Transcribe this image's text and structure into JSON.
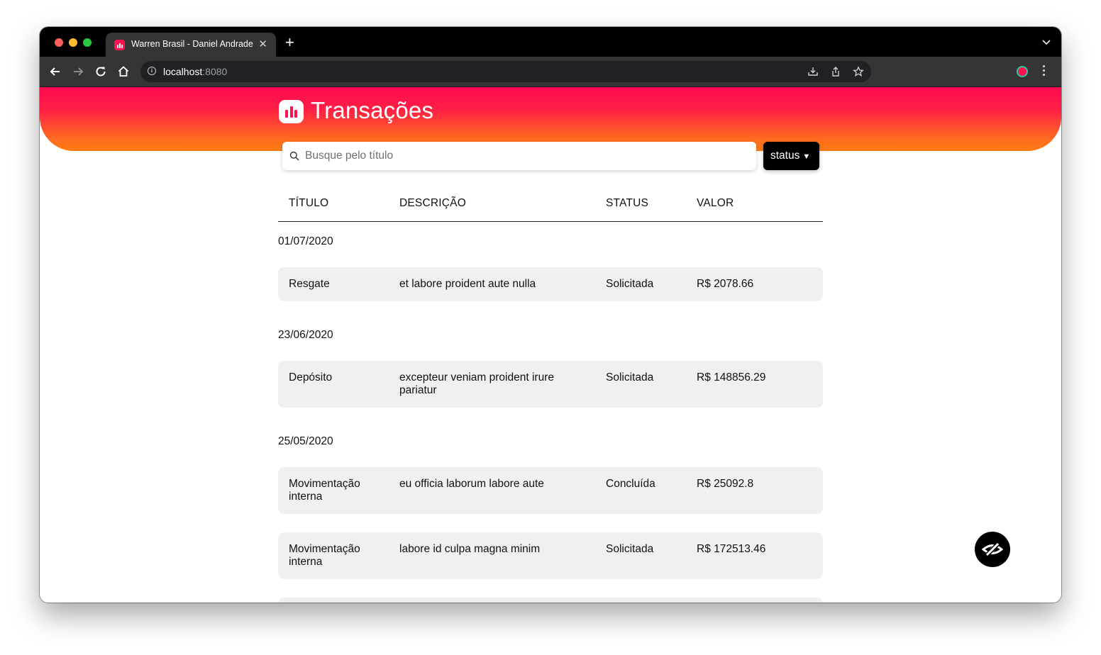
{
  "browser": {
    "tab_title": "Warren Brasil - Daniel Andrade",
    "tab_close_glyph": "✕",
    "new_tab_glyph": "+",
    "url_host": "localhost",
    "url_port": ":8080",
    "url_info_glyph": "i"
  },
  "header": {
    "title": "Transações",
    "brand_color": "#ff1451"
  },
  "search": {
    "placeholder": "Busque pelo título",
    "value": ""
  },
  "filter": {
    "label": "status",
    "caret": "▼"
  },
  "table": {
    "headers": [
      "TÍTULO",
      "DESCRIÇÃO",
      "STATUS",
      "VALOR"
    ],
    "groups": [
      {
        "date": "01/07/2020",
        "rows": [
          {
            "title": "Resgate",
            "description": "et labore proident aute nulla",
            "status": "Solicitada",
            "value": "R$ 2078.66"
          }
        ]
      },
      {
        "date": "23/06/2020",
        "rows": [
          {
            "title": "Depósito",
            "description": "excepteur veniam proident irure pariatur",
            "status": "Solicitada",
            "value": "R$ 148856.29"
          }
        ]
      },
      {
        "date": "25/05/2020",
        "rows": [
          {
            "title": "Movimentação interna",
            "description": "eu officia laborum labore aute",
            "status": "Concluída",
            "value": "R$ 25092.8"
          },
          {
            "title": "Movimentação interna",
            "description": "labore id culpa magna minim",
            "status": "Solicitada",
            "value": "R$ 172513.46"
          }
        ]
      }
    ]
  },
  "icons": {
    "fab": "eye-slash-icon"
  }
}
